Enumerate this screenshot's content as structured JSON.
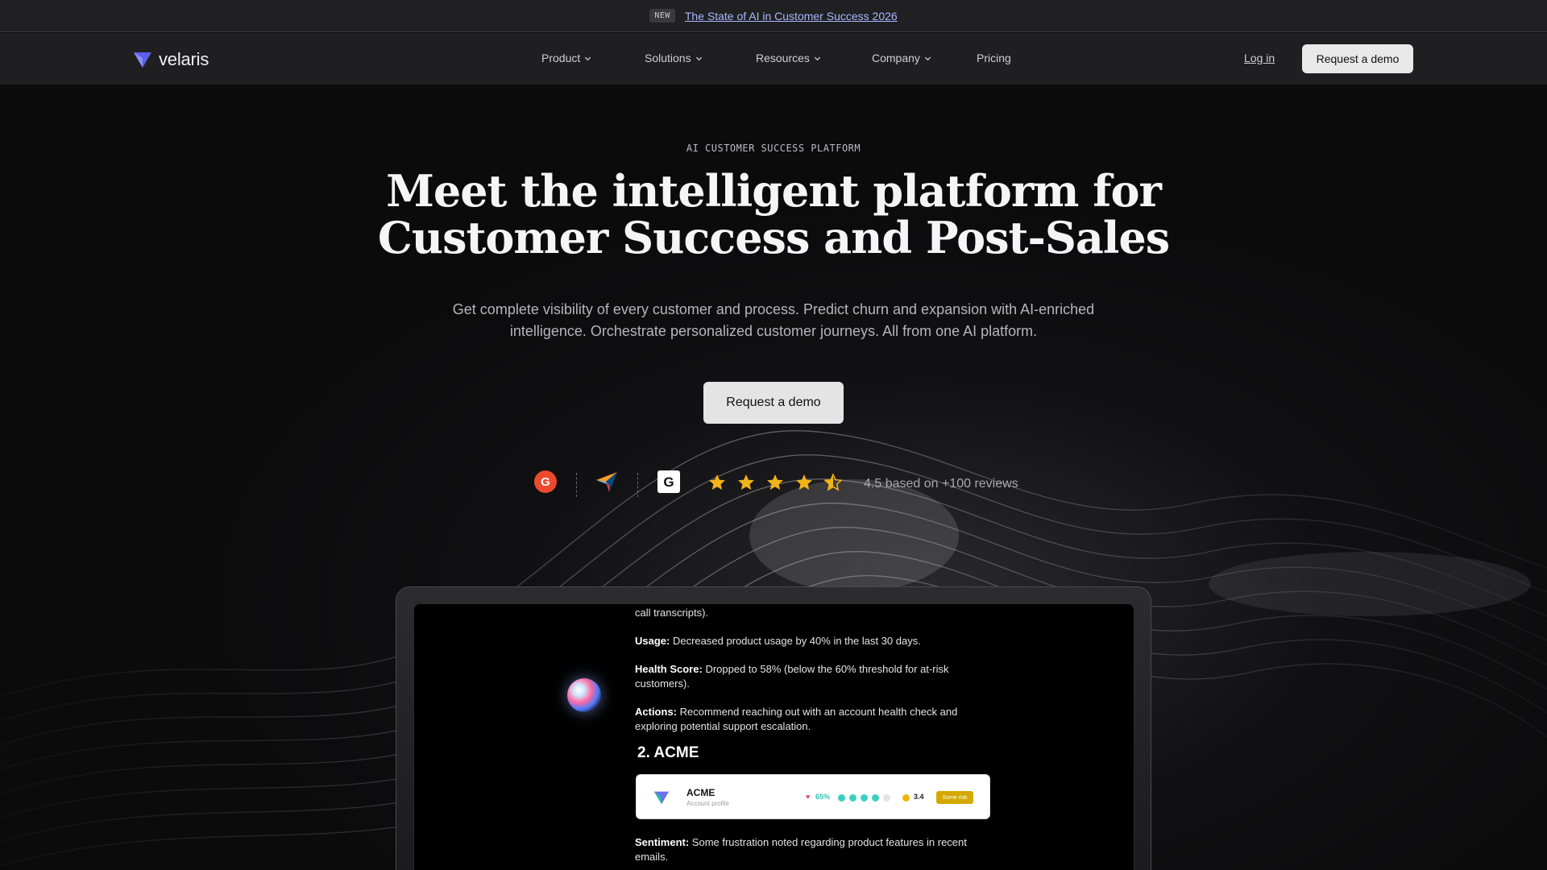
{
  "announcement": {
    "badge": "NEW",
    "link": "The State of AI in Customer Success 2026"
  },
  "nav": {
    "brand": "velaris",
    "items": [
      {
        "label": "Product",
        "dropdown": true
      },
      {
        "label": "Solutions",
        "dropdown": true
      },
      {
        "label": "Resources",
        "dropdown": true
      },
      {
        "label": "Company",
        "dropdown": true
      },
      {
        "label": "Pricing",
        "dropdown": false
      }
    ],
    "login": "Log in",
    "cta": "Request a demo"
  },
  "hero": {
    "eyebrow": "AI CUSTOMER SUCCESS PLATFORM",
    "headline_line1": "Meet the intelligent platform for",
    "headline_line2": "Customer Success and Post-Sales",
    "subtitle": "Get complete visibility of every customer and process. Predict churn and expansion with AI-enriched intelligence. Orchestrate personalized customer journeys. All from one AI platform.",
    "cta": "Request a demo"
  },
  "reviews": {
    "platforms": [
      "g2-icon",
      "capterra-icon",
      "gartner-icon"
    ],
    "rating": 4.5,
    "text": "4.5 based on +100 reviews",
    "star_color": "#f2b318"
  },
  "mockup": {
    "line_fragment": "call transcripts).",
    "usage_label": "Usage:",
    "usage_text": "Decreased product usage by 40% in the last 30 days.",
    "health_label": "Health Score:",
    "health_text": "Dropped to 58% (below the 60% threshold for at-risk customers).",
    "actions_label": "Actions:",
    "actions_text": "Recommend reaching out with an account health check and exploring potential support escalation.",
    "section_title": "2. ACME",
    "card": {
      "name": "ACME",
      "subtitle": "Account profile",
      "heart": "♥",
      "percent": "65%",
      "score": "3.4",
      "risk": "Some risk"
    },
    "sentiment_label": "Sentiment:",
    "sentiment_text": "Some frustration noted regarding product features in recent emails."
  },
  "colors": {
    "accent": "#a9b6ff",
    "brand": "#6a6ff0",
    "cta_bg": "#e9e9ea"
  }
}
